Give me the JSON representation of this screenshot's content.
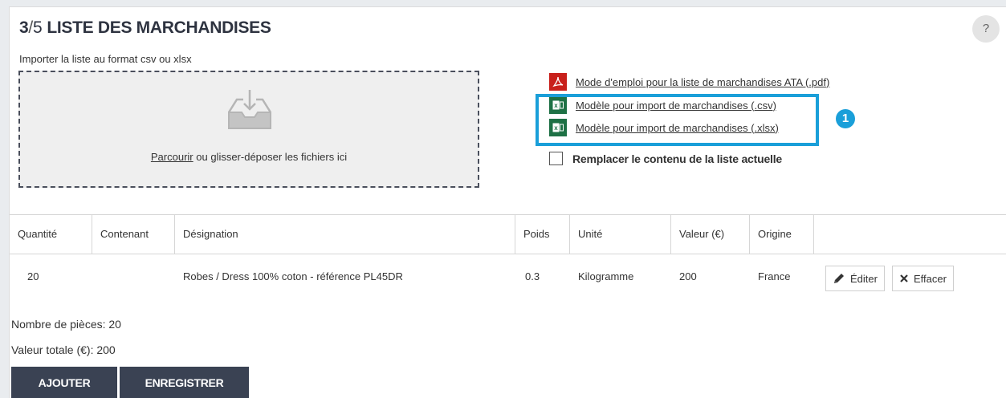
{
  "header": {
    "step": "3",
    "slash": "/",
    "total": "5",
    "title": "LISTE DES MARCHANDISES",
    "help_label": "?"
  },
  "import": {
    "label": "Importer la liste au format csv ou xlsx",
    "browse_link": "Parcourir",
    "drop_text": " ou glisser-déposer les fichiers ici"
  },
  "documents": [
    {
      "label": "Mode d'emploi pour la liste de marchandises ATA (.pdf)",
      "icon": "pdf-file-icon"
    },
    {
      "label": "Modèle pour import de marchandises (.csv)",
      "icon": "excel-file-icon"
    },
    {
      "label": "Modèle pour import de marchandises (.xlsx)",
      "icon": "excel-file-icon"
    }
  ],
  "callout": {
    "number": "1",
    "color": "#1a9fd9"
  },
  "replace_checkbox": {
    "label": "Remplacer le contenu de la liste actuelle",
    "checked": false
  },
  "table": {
    "columns": [
      "Quantité",
      "Contenant",
      "Désignation",
      "Poids",
      "Unité",
      "Valeur (€)",
      "Origine"
    ],
    "rows": [
      {
        "quantite": "20",
        "contenant": "",
        "designation": "Robes / Dress 100% coton - référence PL45DR",
        "poids": "0.3",
        "unite": "Kilogramme",
        "valeur": "200",
        "origine": "France"
      }
    ],
    "edit_label": "Éditer",
    "delete_label": "Effacer"
  },
  "summary": {
    "pieces": "Nombre de pièces: 20",
    "total_value": "Valeur totale (€): 200"
  },
  "buttons": {
    "add": "AJOUTER",
    "save": "ENREGISTRER"
  },
  "colors": {
    "accent": "#1a9fd9",
    "button_dark": "#3a4253",
    "pdf_red": "#c8201b",
    "excel_green": "#1e7145"
  }
}
